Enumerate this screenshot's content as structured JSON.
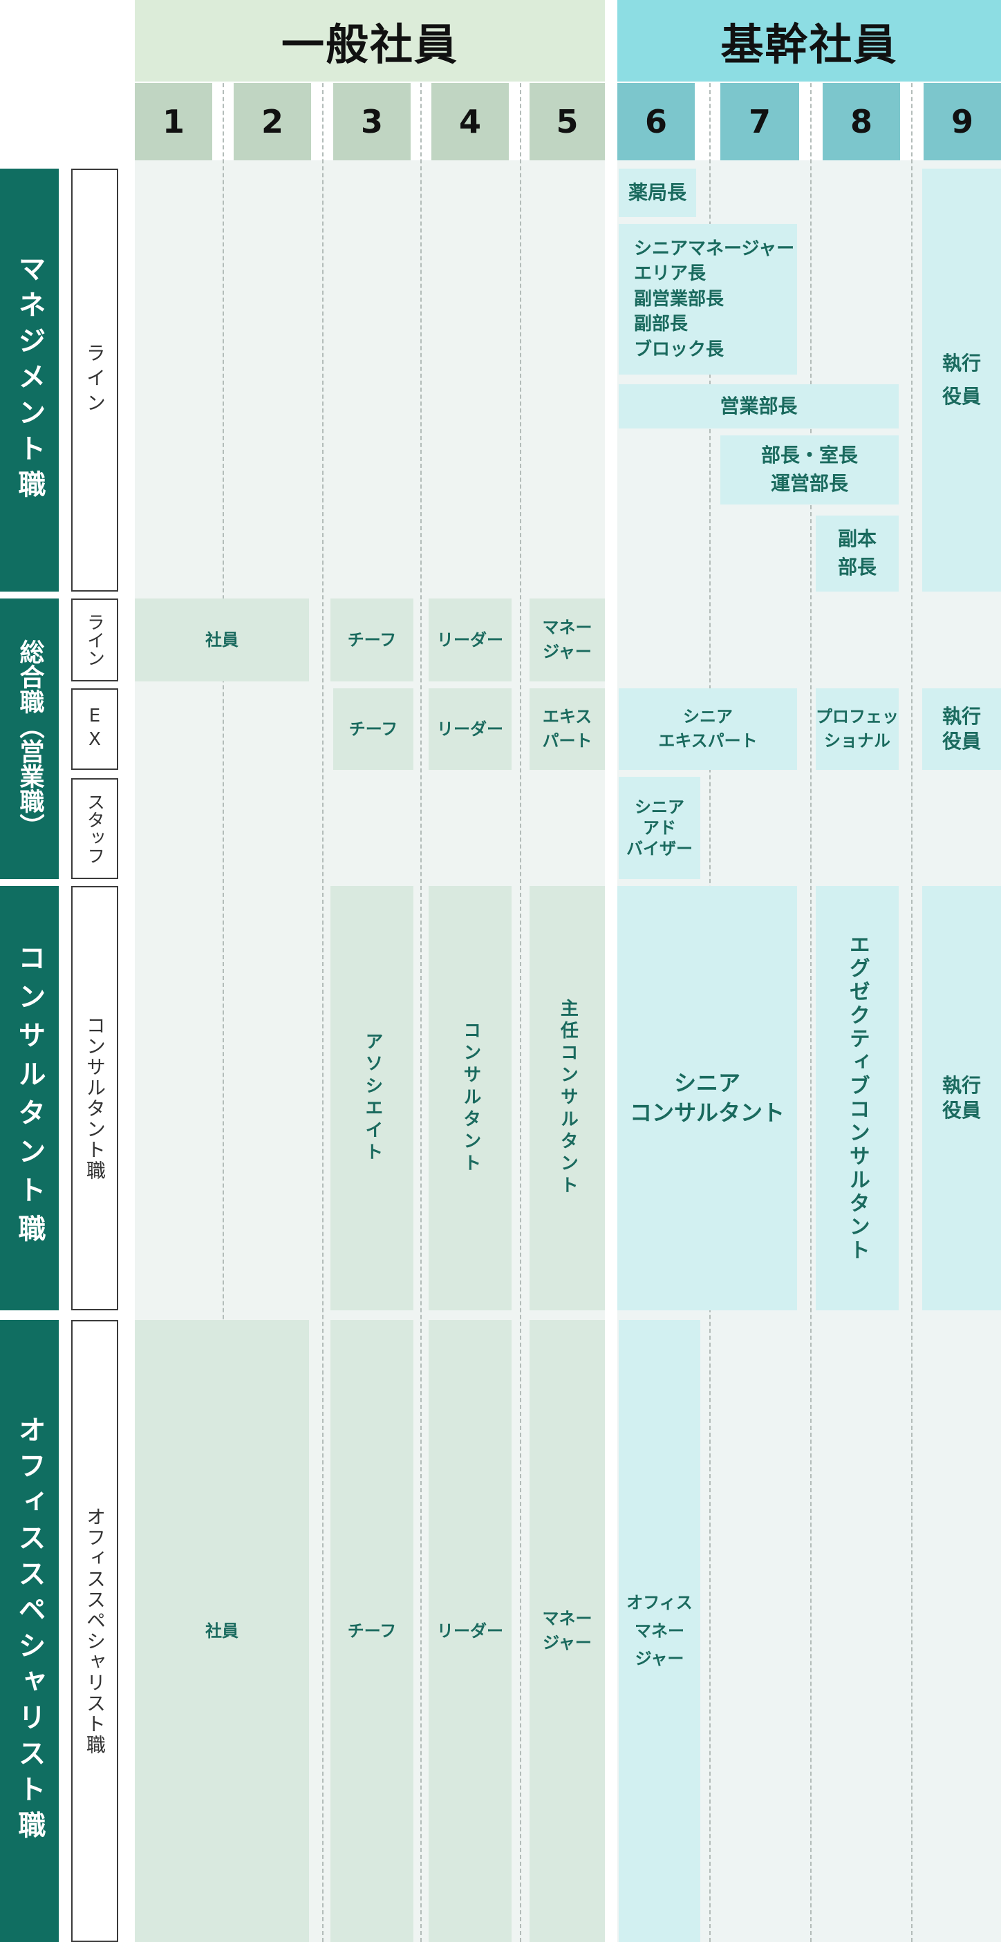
{
  "headers": {
    "general": "一般社員",
    "core": "基幹社員",
    "levels": [
      "1",
      "2",
      "3",
      "4",
      "5",
      "6",
      "7",
      "8",
      "9"
    ]
  },
  "categories": {
    "management": "マネジメント職",
    "sogo": "総合職（営業職）",
    "consultant": "コンサルタント職",
    "office": "オフィススペシャリスト職"
  },
  "subcategories": {
    "line": "ライン",
    "sogo_line": "ライン",
    "ex": "EX",
    "staff": "スタッフ",
    "consultant": "コンサルタント職",
    "office": "オフィススペシャリスト職"
  },
  "management": {
    "pharmacy_head": "薬局長",
    "senior_group": "シニアマネージャー\nエリア長\n副営業部長\n副部長\nブロック長",
    "sales_director": "営業部長",
    "director": "部長・室長\n運営部長",
    "deputy_head": "副本\n部長",
    "executive": "執行\n役員"
  },
  "sogo_line": {
    "staff": "社員",
    "chief": "チーフ",
    "leader": "リーダー",
    "manager": "マネー\nジャー"
  },
  "sogo_ex": {
    "chief": "チーフ",
    "leader": "リーダー",
    "expert": "エキス\nパート",
    "senior_expert": "シニア\nエキスパート",
    "professional": "プロフェッ\nショナル",
    "executive": "執行\n役員"
  },
  "sogo_staff": {
    "senior_advisor": "シニア\nアド\nバイザー"
  },
  "consultant": {
    "associate": "アソシエイト",
    "consultant": "コンサルタント",
    "chief_consultant": "主任コンサルタント",
    "senior_consultant": "シニア\nコンサルタント",
    "executive_consultant": "エグゼクティブコンサルタント",
    "executive": "執行\n役員"
  },
  "office": {
    "staff": "社員",
    "chief": "チーフ",
    "leader": "リーダー",
    "manager": "マネー\nジャー",
    "office_manager": "オフィス\nマネー\nジャー"
  }
}
